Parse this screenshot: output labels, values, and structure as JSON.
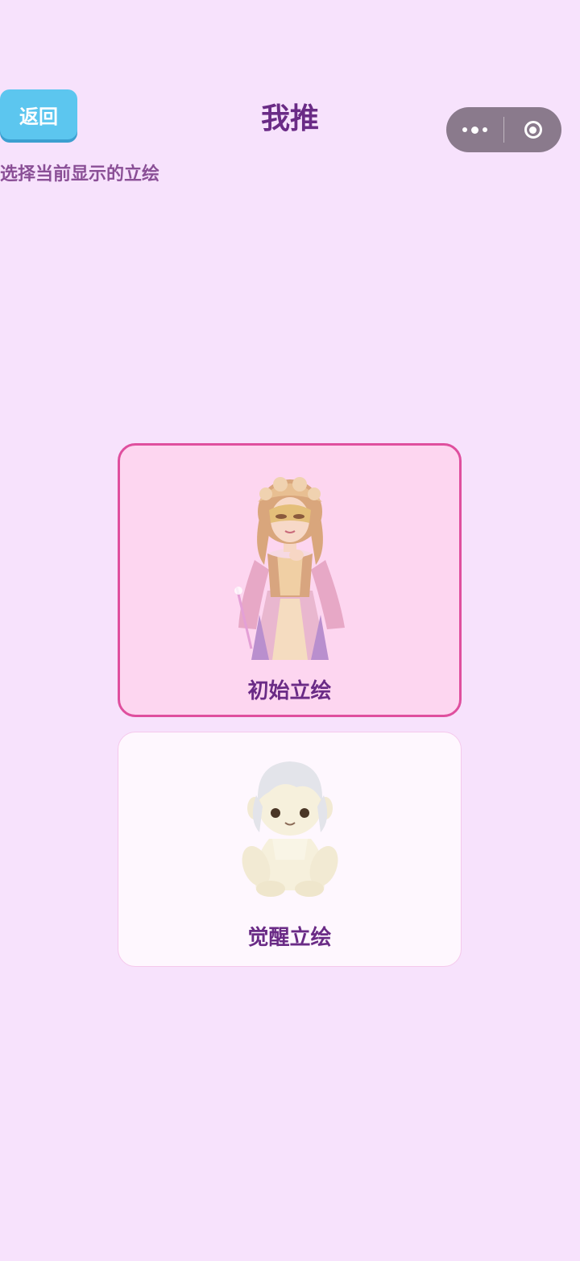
{
  "header": {
    "back_label": "返回",
    "title": "我推"
  },
  "capsule": {
    "more_icon": "more-dots-icon",
    "close_icon": "target-close-icon"
  },
  "subtitle": "选择当前显示的立绘",
  "options": [
    {
      "label": "初始立绘",
      "selected": true,
      "image": "masquerade-character-illustration"
    },
    {
      "label": "觉醒立绘",
      "selected": false,
      "image": "white-plush-doll-illustration"
    }
  ],
  "colors": {
    "background": "#f7e2fc",
    "accent": "#6a2b86",
    "selected_border": "#df4f9e",
    "back_button": "#5cc6ef"
  }
}
